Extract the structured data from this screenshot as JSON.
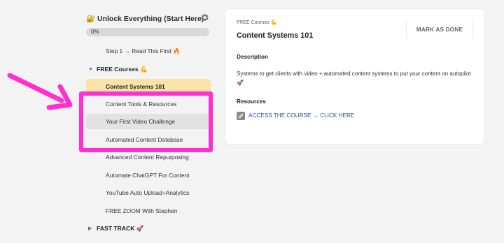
{
  "sidebar": {
    "course_title": "🔐 Unlock Everything (Start Here)",
    "progress_label": "0%",
    "progress": 0,
    "lesson_step1": "Step 1 → Read This First 🔥",
    "section_free": "FREE Courses 💪",
    "lessons": [
      "Content Systems 101",
      "Content Tools & Resources",
      "Your First Video Challenge",
      "Automated Content Database",
      "Advanced Content Repurposing",
      "Automate ChatGPT For Content",
      "YouTube Auto Upload+Analytics",
      "FREE ZOOM With Stephen"
    ],
    "section_fast": "FAST TRACK 🚀"
  },
  "main": {
    "breadcrumb": "FREE Courses 💪",
    "title": "Content Systems 101",
    "mark_done": "MARK AS DONE",
    "description_heading": "Description",
    "description": "Systems to get clients with video + automated content systems to put your content on autopilot 🚀",
    "resources_heading": "Resources",
    "resource_link": "ACCESS THE COURSE → CLICK HERE"
  },
  "colors": {
    "active_lesson": "#fbe3a6",
    "hover_lesson": "#e2e2e2",
    "highlight": "#ff2fd0",
    "link": "#2a4fa8"
  }
}
